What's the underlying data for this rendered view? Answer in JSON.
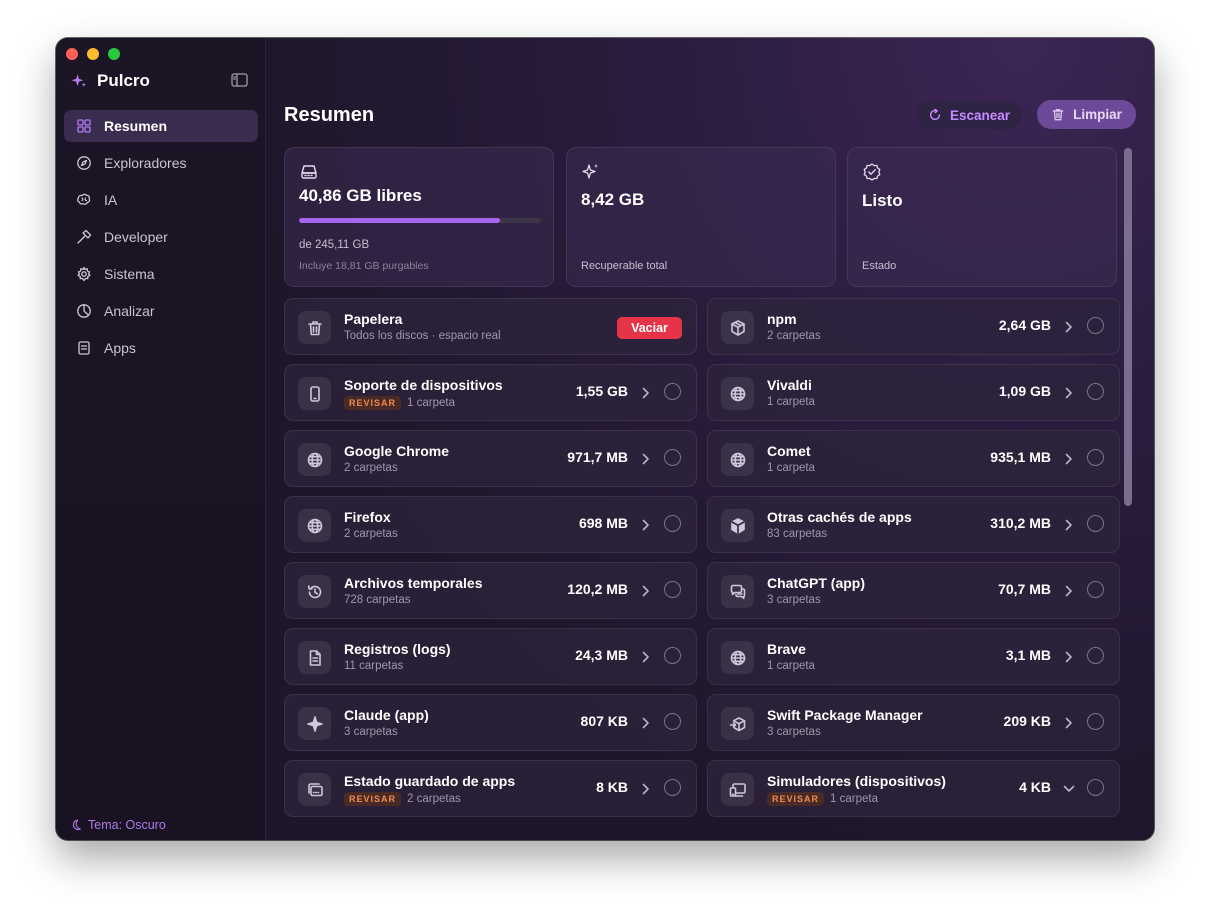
{
  "app": {
    "title": "Pulcro"
  },
  "sidebar": {
    "items": [
      {
        "label": "Resumen",
        "icon": "grid-icon",
        "active": true
      },
      {
        "label": "Exploradores",
        "icon": "compass-icon"
      },
      {
        "label": "IA",
        "icon": "brain-icon"
      },
      {
        "label": "Developer",
        "icon": "hammer-icon"
      },
      {
        "label": "Sistema",
        "icon": "gear-icon"
      },
      {
        "label": "Analizar",
        "icon": "pie-chart-icon"
      },
      {
        "label": "Apps",
        "icon": "app-box-icon"
      }
    ],
    "theme_label": "Tema: Oscuro"
  },
  "header": {
    "title": "Resumen",
    "scan_label": "Escanear",
    "clean_label": "Limpiar"
  },
  "stats": {
    "disk": {
      "value": "40,86 GB libres",
      "total": "de 245,11 GB",
      "note": "Incluye 18,81 GB purgables",
      "used_fraction": 0.83
    },
    "recoverable": {
      "value": "8,42 GB",
      "label": "Recuperable total"
    },
    "status": {
      "value": "Listo",
      "label": "Estado"
    }
  },
  "trash": {
    "title": "Papelera",
    "subtitle": "Todos los discos · espacio real",
    "action_label": "Vaciar"
  },
  "items_left": [
    {
      "title": "Soporte de dispositivos",
      "badge": "REVISAR",
      "subtitle": "1 carpeta",
      "size": "1,55 GB",
      "icon": "phone-icon"
    },
    {
      "title": "Google Chrome",
      "subtitle": "2 carpetas",
      "size": "971,7 MB",
      "icon": "globe-icon"
    },
    {
      "title": "Firefox",
      "subtitle": "2 carpetas",
      "size": "698 MB",
      "icon": "globe-icon"
    },
    {
      "title": "Archivos temporales",
      "subtitle": "728 carpetas",
      "size": "120,2 MB",
      "icon": "history-icon"
    },
    {
      "title": "Registros (logs)",
      "subtitle": "11 carpetas",
      "size": "24,3 MB",
      "icon": "document-icon"
    },
    {
      "title": "Claude (app)",
      "subtitle": "3 carpetas",
      "size": "807 KB",
      "icon": "sparkle-icon"
    },
    {
      "title": "Estado guardado de apps",
      "badge": "REVISAR",
      "subtitle": "2 carpetas",
      "size": "8 KB",
      "icon": "windows-icon"
    }
  ],
  "items_right": [
    {
      "title": "npm",
      "subtitle": "2 carpetas",
      "size": "2,64 GB",
      "icon": "package-icon"
    },
    {
      "title": "Vivaldi",
      "subtitle": "1 carpeta",
      "size": "1,09 GB",
      "icon": "globe-icon"
    },
    {
      "title": "Comet",
      "subtitle": "1 carpeta",
      "size": "935,1 MB",
      "icon": "globe-icon"
    },
    {
      "title": "Otras cachés de apps",
      "subtitle": "83 carpetas",
      "size": "310,2 MB",
      "icon": "cube-icon"
    },
    {
      "title": "ChatGPT (app)",
      "subtitle": "3 carpetas",
      "size": "70,7 MB",
      "icon": "chat-bubbles-icon"
    },
    {
      "title": "Brave",
      "subtitle": "1 carpeta",
      "size": "3,1 MB",
      "icon": "globe-icon"
    },
    {
      "title": "Swift Package Manager",
      "subtitle": "3 carpetas",
      "size": "209 KB",
      "icon": "package-move-icon"
    },
    {
      "title": "Simuladores (dispositivos)",
      "badge": "REVISAR",
      "subtitle": "1 carpeta",
      "size": "4 KB",
      "icon": "devices-icon",
      "expanded": true
    }
  ],
  "colors": {
    "accent": "#a864f2",
    "danger": "#e5344a",
    "badge": "#ef8a52"
  }
}
